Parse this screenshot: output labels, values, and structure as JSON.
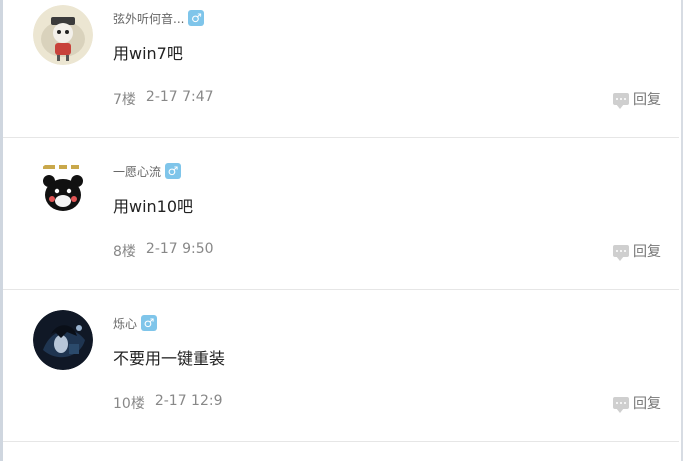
{
  "posts": [
    {
      "username": "弦外听何音...",
      "gender_icon": "male-symbol-icon",
      "gender_symbol": "♂",
      "content": "用win7吧",
      "floor": "7楼",
      "timestamp": "2-17 7:47",
      "reply_label": "回复",
      "avatar": "plush-figure-photo"
    },
    {
      "username": "一愿心流",
      "gender_icon": "male-symbol-icon",
      "gender_symbol": "♂",
      "content": "用win10吧",
      "floor": "8楼",
      "timestamp": "2-17 9:50",
      "reply_label": "回复",
      "avatar": "black-bear-cartoon"
    },
    {
      "username": "烁心",
      "gender_icon": "male-symbol-icon",
      "gender_symbol": "♂",
      "content": "不要用一键重装",
      "floor": "10楼",
      "timestamp": "2-17 12:9",
      "reply_label": "回复",
      "avatar": "anime-character-dark"
    }
  ],
  "colors": {
    "gender_badge": "#7fc5ea",
    "reply_icon": "#cfcfcf",
    "meta_text": "#888888"
  }
}
